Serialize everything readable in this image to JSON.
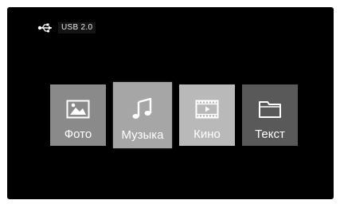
{
  "device": {
    "icon": "usb-icon",
    "label": "USB 2.0"
  },
  "tiles": [
    {
      "label": "Фото",
      "icon": "photo-icon",
      "color": "#8a8a8a"
    },
    {
      "label": "Музыка",
      "icon": "music-icon",
      "color": "#a6a6a6",
      "selected": true
    },
    {
      "label": "Кино",
      "icon": "video-icon",
      "color": "#b9b9b9"
    },
    {
      "label": "Текст",
      "icon": "folder-icon",
      "color": "#595959"
    }
  ]
}
